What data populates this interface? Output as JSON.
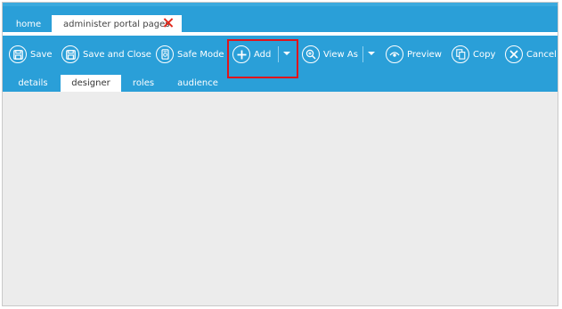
{
  "document_tabs": [
    {
      "label": "home",
      "active": false
    },
    {
      "label": "administer portal pages",
      "active": true,
      "closable": true,
      "close_icon": "close-x-icon"
    }
  ],
  "toolbar": {
    "buttons": [
      {
        "id": "save",
        "label": "Save",
        "icon": "floppy-disk-icon"
      },
      {
        "id": "save_close",
        "label": "Save and Close",
        "icon": "floppy-disk-icon"
      },
      {
        "id": "safe_mode",
        "label": "Safe Mode",
        "icon": "safe-mode-icon"
      },
      {
        "id": "add",
        "label": "Add",
        "icon": "plus-circle-icon",
        "has_dropdown": true,
        "highlighted": true
      },
      {
        "id": "view_as",
        "label": "View As",
        "icon": "magnifier-plus-icon",
        "has_dropdown": true
      },
      {
        "id": "preview",
        "label": "Preview",
        "icon": "eye-icon"
      },
      {
        "id": "copy",
        "label": "Copy",
        "icon": "copy-icon"
      },
      {
        "id": "cancel",
        "label": "Cancel",
        "icon": "x-circle-icon"
      }
    ]
  },
  "sub_tabs": [
    {
      "label": "details",
      "active": false
    },
    {
      "label": "designer",
      "active": true
    },
    {
      "label": "roles",
      "active": false
    },
    {
      "label": "audience",
      "active": false
    }
  ],
  "colors": {
    "toolbar_blue": "#2a9fd8",
    "highlight_red": "#e0141c",
    "close_red": "#e0291c",
    "canvas_gray": "#ececec"
  }
}
